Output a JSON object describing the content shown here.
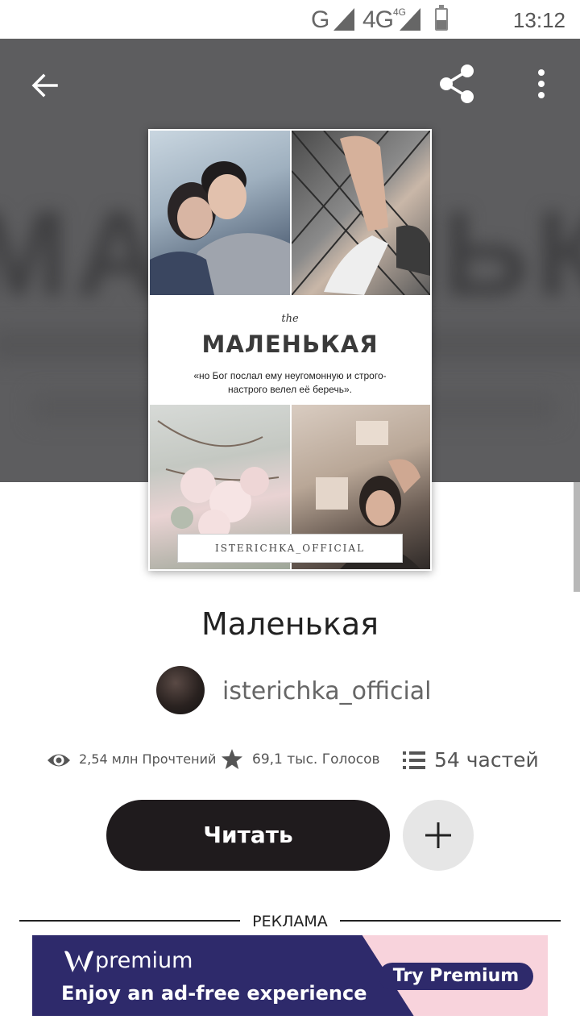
{
  "status_bar": {
    "network_1": "G",
    "network_2": "4G",
    "network_2_sub": "4G",
    "time": "13:12",
    "icons": [
      "signal-icon",
      "signal-icon",
      "battery-icon"
    ]
  },
  "toolbar": {
    "back_icon": "arrow-left-icon",
    "share_icon": "share-icon",
    "more_icon": "more-vertical-icon"
  },
  "cover": {
    "the": "the",
    "title": "МАЛЕНЬКАЯ",
    "quote": "«но Бог послал ему неугомонную и строго-настрого велел её беречь».",
    "author": "ISTERICHKA_OFFICIAL"
  },
  "story": {
    "title": "Маленькая",
    "author": "isterichka_official"
  },
  "stats": {
    "reads": "2,54 млн Прочтений",
    "votes": "69,1 тыс. Голосов",
    "parts": "54 частей",
    "icons": [
      "eye-icon",
      "star-icon",
      "list-icon"
    ]
  },
  "actions": {
    "read_label": "Читать",
    "add_icon": "plus-icon"
  },
  "ad": {
    "label": "РЕКЛАМА",
    "brand": "premium",
    "tagline": "Enjoy an ad-free experience",
    "cta": "Try Premium"
  },
  "colors": {
    "header_bg": "#5d5d5f",
    "read_button": "#1f1b1d",
    "add_button": "#e6e6e6",
    "ad_dark": "#2e2a6b",
    "ad_pink": "#f8d3dc"
  }
}
